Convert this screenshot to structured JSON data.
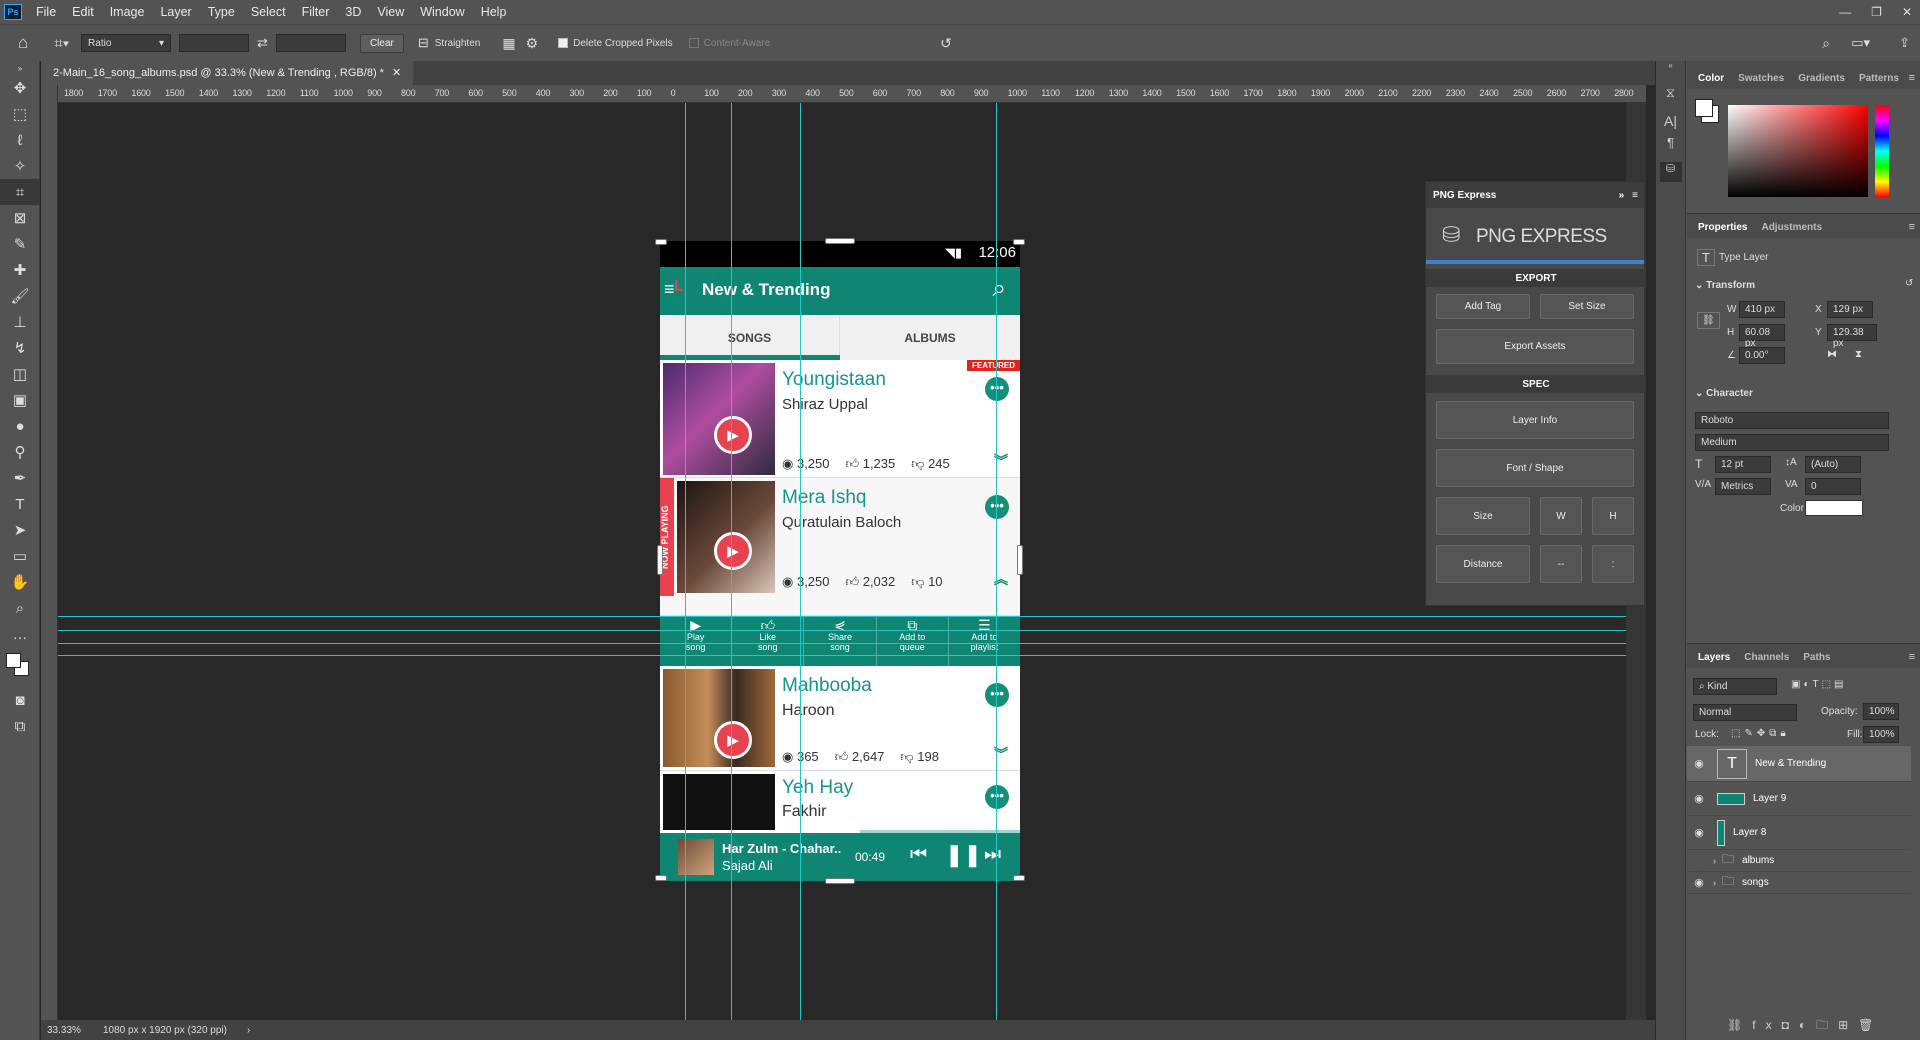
{
  "menubar": {
    "items": [
      "File",
      "Edit",
      "Image",
      "Layer",
      "Type",
      "Select",
      "Filter",
      "3D",
      "View",
      "Window",
      "Help"
    ]
  },
  "options": {
    "ratio": "Ratio",
    "clear": "Clear",
    "straighten": "Straighten",
    "delete_cropped": "Delete Cropped Pixels",
    "content_aware": "Content-Aware"
  },
  "document": {
    "tab_title": "2-Main_16_song_albums.psd @ 33.3% (New & Trending , RGB/8) *",
    "zoom": "33.33%",
    "doc_info": "1080 px x 1920 px (320 ppi)"
  },
  "ruler": {
    "ticks": [
      "1800",
      "1700",
      "1600",
      "1500",
      "1400",
      "1300",
      "1200",
      "1100",
      "1000",
      "900",
      "800",
      "700",
      "600",
      "500",
      "400",
      "300",
      "200",
      "100",
      "0",
      "100",
      "200",
      "300",
      "400",
      "500",
      "600",
      "700",
      "800",
      "900",
      "1000",
      "1100",
      "1200",
      "1300",
      "1400",
      "1500",
      "1600",
      "1700",
      "1800",
      "1900",
      "2000",
      "2100",
      "2200",
      "2300",
      "2400",
      "2500",
      "2600",
      "2700",
      "2800"
    ]
  },
  "app": {
    "time": "12:06",
    "title": "New & Trending",
    "tabs": [
      "SONGS",
      "ALBUMS"
    ],
    "songs": [
      {
        "title": "Youngistaan",
        "artist": "Shiraz Uppal",
        "views": "3,250",
        "likes": "1,235",
        "dislikes": "245",
        "featured": "FEATURED"
      },
      {
        "title": "Mera Ishq",
        "artist": "Quratulain Baloch",
        "views": "3,250",
        "likes": "2,032",
        "dislikes": "10",
        "now_playing": "NOW PLAYING"
      },
      {
        "title": "Mahbooba",
        "artist": "Haroon",
        "views": "365",
        "likes": "2,647",
        "dislikes": "198"
      },
      {
        "title": "Yeh Hay",
        "artist": "Fakhir"
      }
    ],
    "actions": [
      {
        "l1": "Play",
        "l2": "song"
      },
      {
        "l1": "Like",
        "l2": "song"
      },
      {
        "l1": "Share",
        "l2": "song"
      },
      {
        "l1": "Add to",
        "l2": "queue"
      },
      {
        "l1": "Add to",
        "l2": "playlist"
      }
    ],
    "player": {
      "title": "Har Zulm - Chahar..",
      "artist": "Sajad Ali",
      "time": "00:49"
    }
  },
  "pngexpress": {
    "title": "PNG Express",
    "logo": "PNG EXPRESS",
    "export": "EXPORT",
    "add_tag": "Add Tag",
    "set_size": "Set Size",
    "export_assets": "Export Assets",
    "spec": "SPEC",
    "layer_info": "Layer Info",
    "font_shape": "Font / Shape",
    "size": "Size",
    "w": "W",
    "h": "H",
    "distance": "Distance",
    "dash": "--",
    "colon": ":"
  },
  "color_panel": {
    "tabs": [
      "Color",
      "Swatches",
      "Gradients",
      "Patterns"
    ]
  },
  "properties": {
    "tabs": [
      "Properties",
      "Adjustments"
    ],
    "type_layer": "Type Layer",
    "transform": "Transform",
    "w_label": "W",
    "w": "410 px",
    "h_label": "H",
    "h": "60.08 px",
    "x_label": "X",
    "x": "129 px",
    "y_label": "Y",
    "y": "129.38 px",
    "angle": "0.00°",
    "character": "Character",
    "font": "Roboto",
    "weight": "Medium",
    "size": "12 pt",
    "leading": "(Auto)",
    "kerning": "Metrics",
    "tracking": "0",
    "color_label": "Color"
  },
  "layers": {
    "tabs": [
      "Layers",
      "Channels",
      "Paths"
    ],
    "kind": "Kind",
    "blend": "Normal",
    "opacity_label": "Opacity:",
    "opacity": "100%",
    "lock_label": "Lock:",
    "fill_label": "Fill:",
    "fill": "100%",
    "items": [
      {
        "name": "New & Trending"
      },
      {
        "name": "Layer 9"
      },
      {
        "name": "Layer 8"
      },
      {
        "name": "albums"
      },
      {
        "name": "songs"
      }
    ]
  }
}
